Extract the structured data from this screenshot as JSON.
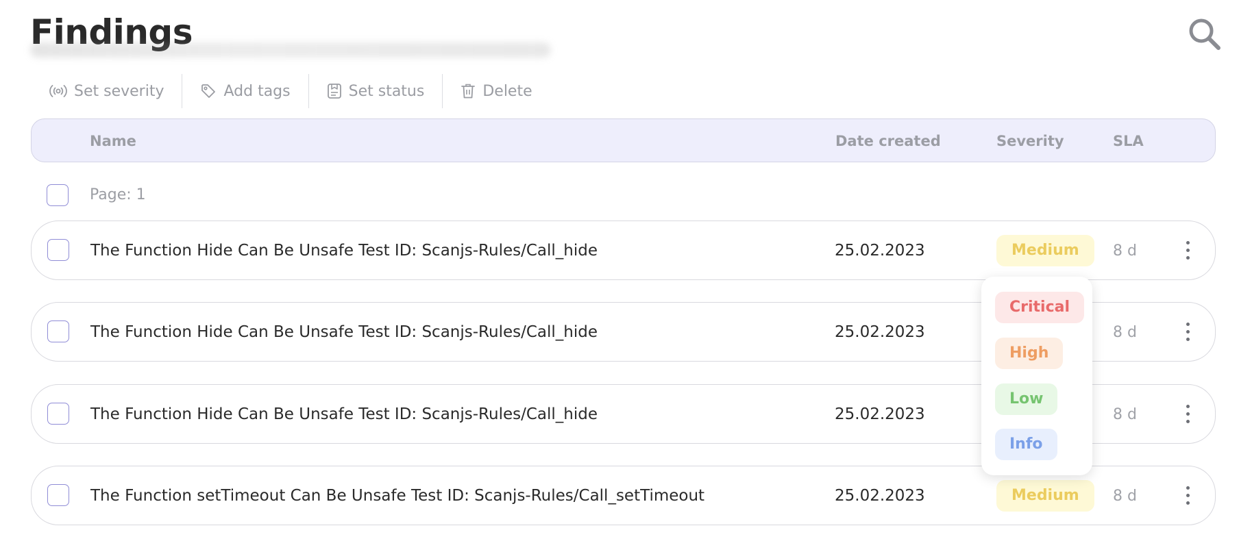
{
  "header": {
    "title": "Findings"
  },
  "toolbar": {
    "set_severity": "Set severity",
    "add_tags": "Add tags",
    "set_status": "Set status",
    "delete": "Delete"
  },
  "table": {
    "columns": {
      "name": "Name",
      "date_created": "Date created",
      "severity": "Severity",
      "sla": "SLA"
    },
    "page_label": "Page: 1",
    "rows": [
      {
        "name": "The Function Hide Can Be Unsafe Test ID: Scanjs-Rules/Call_hide",
        "date": "25.02.2023",
        "severity": "Medium",
        "sla": "8 d"
      },
      {
        "name": "The Function Hide Can Be Unsafe Test ID: Scanjs-Rules/Call_hide",
        "date": "25.02.2023",
        "severity": "",
        "sla": "8 d"
      },
      {
        "name": "The Function Hide Can Be Unsafe Test ID: Scanjs-Rules/Call_hide",
        "date": "25.02.2023",
        "severity": "",
        "sla": "8 d"
      },
      {
        "name": "The Function setTimeout Can Be Unsafe Test ID: Scanjs-Rules/Call_setTimeout",
        "date": "25.02.2023",
        "severity": "Medium",
        "sla": "8 d"
      }
    ]
  },
  "severity_dropdown": {
    "options": [
      "Critical",
      "High",
      "Low",
      "Info"
    ]
  },
  "colors": {
    "accent": "#8f8cd6",
    "header_bg": "#eeeefc",
    "medium": "#ebcc5e",
    "critical": "#e86a6a",
    "high": "#ee9d62",
    "low": "#76c470",
    "info": "#7ba0e8"
  },
  "icons": [
    "search-icon",
    "broadcast-icon",
    "tag-icon",
    "status-icon",
    "trash-icon",
    "kebab-menu-icon"
  ]
}
